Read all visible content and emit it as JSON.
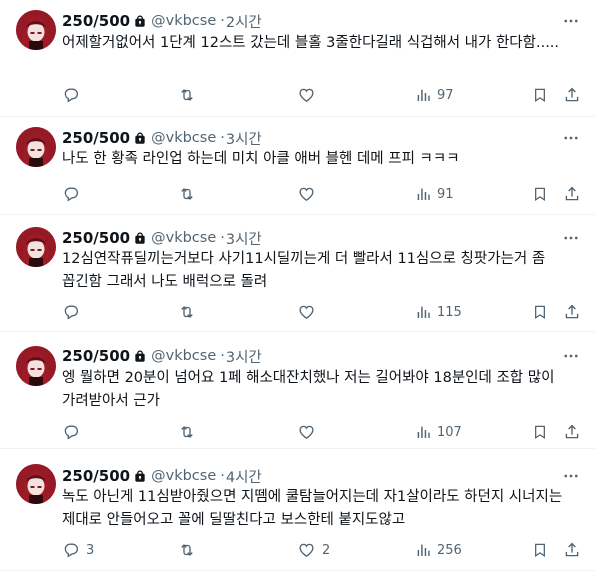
{
  "colors": {
    "text": "#0f1419",
    "muted": "#536471",
    "divider": "#eff3f4",
    "avatar_hair": "#8a1822"
  },
  "tweets": [
    {
      "name": "250/500",
      "handle": "@vkbcse",
      "dot": "·",
      "time": "2시간",
      "text": "어제할거없어서 1단계 12스트 갔는데 블홀 3줄한다길래 식겁해서 내가 한다함.....",
      "replies": "",
      "retweets": "",
      "likes": "",
      "views": "97"
    },
    {
      "name": "250/500",
      "handle": "@vkbcse",
      "dot": "·",
      "time": "3시간",
      "text": "나도 한 황족 라인업 하는데 미치 아클 애버 블헨 데메 프피 ㅋㅋㅋ",
      "replies": "",
      "retweets": "",
      "likes": "",
      "views": "91"
    },
    {
      "name": "250/500",
      "handle": "@vkbcse",
      "dot": "·",
      "time": "3시간",
      "text": "12심연작퓨딜끼는거보다 사기11시딜끼는게 더 빨라서 11심으로 칭팟가는거 좀 꼽긴함 그래서 나도 배럭으로 돌려",
      "replies": "",
      "retweets": "",
      "likes": "",
      "views": "115"
    },
    {
      "name": "250/500",
      "handle": "@vkbcse",
      "dot": "·",
      "time": "3시간",
      "text": "엥 뭘하면 20분이 넘어요 1페 해소대잔치했나  저는 길어봐야 18분인데 조합 많이 가려받아서 근가",
      "replies": "",
      "retweets": "",
      "likes": "",
      "views": "107"
    },
    {
      "name": "250/500",
      "handle": "@vkbcse",
      "dot": "·",
      "time": "4시간",
      "text": "녹도 아닌게 11심받아줬으면 지뗌에 쿨탐늘어지는데 자1살이라도 하던지 시너지는 제대로 안들어오고 꼴에 딜딸친다고 보스한테 붙지도않고",
      "replies": "3",
      "retweets": "",
      "likes": "2",
      "views": "256"
    }
  ]
}
